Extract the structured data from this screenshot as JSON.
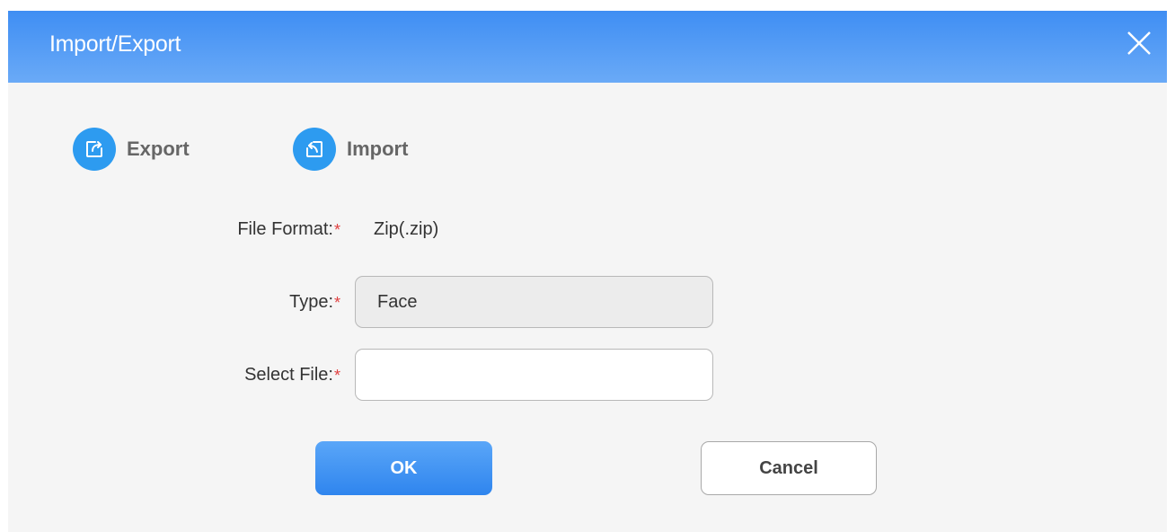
{
  "dialog": {
    "title": "Import/Export"
  },
  "tabs": [
    {
      "label": "Export",
      "icon": "export-icon"
    },
    {
      "label": "Import",
      "icon": "import-icon"
    }
  ],
  "form": {
    "file_format": {
      "label": "File Format:",
      "required_mark": "*",
      "value": "Zip(.zip)"
    },
    "type": {
      "label": "Type:",
      "required_mark": "*",
      "value": "Face"
    },
    "select_file": {
      "label": "Select File:",
      "required_mark": "*",
      "value": ""
    }
  },
  "buttons": {
    "ok": "OK",
    "cancel": "Cancel"
  },
  "colors": {
    "title_bar": "#3f8ef3",
    "tab_icon_bg": "#2d9bf0",
    "required": "#e04040",
    "ok_button": "#2f85ee"
  }
}
